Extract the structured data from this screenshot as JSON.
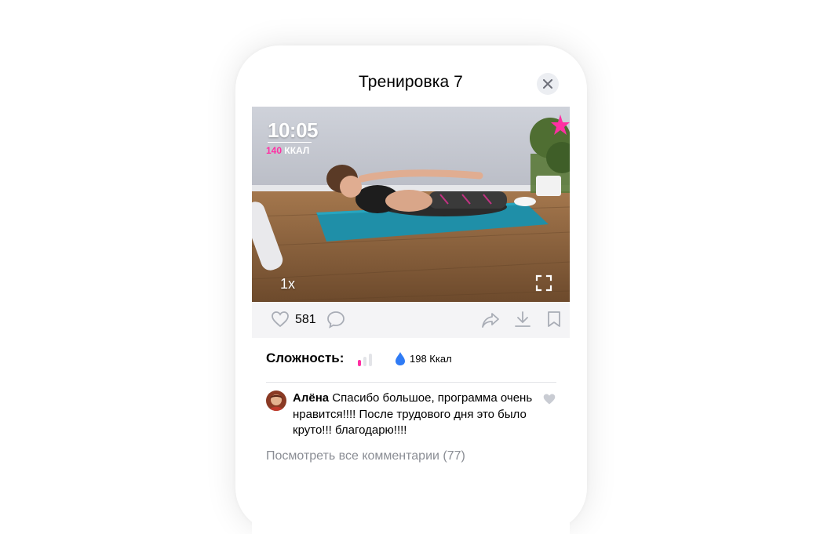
{
  "header": {
    "title": "Тренировка 7"
  },
  "video": {
    "overlay_time": "10:05",
    "overlay_kcal_value": "140",
    "overlay_kcal_unit": "ККАЛ",
    "speed": "1x"
  },
  "actions": {
    "like_count": "581"
  },
  "details": {
    "difficulty_label": "Сложность:",
    "difficulty_level": 1,
    "difficulty_max": 3,
    "kcal": "198 Ккал"
  },
  "comment": {
    "author": "Алёна",
    "text": "Спасибо большое, программа очень нравится!!!! После трудового дня это было круто!!! благодарю!!!!"
  },
  "view_all": "Посмотреть все комментарии (77)",
  "colors": {
    "accent_pink": "#ff2fa3",
    "water_blue": "#2f7bf5",
    "icon_gray": "#a9adb6"
  }
}
